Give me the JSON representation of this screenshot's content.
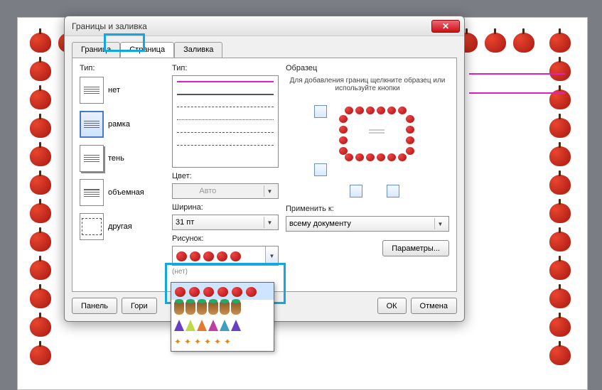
{
  "dialog": {
    "title": "Границы и заливка",
    "tabs": {
      "border": "Граница",
      "page": "Страница",
      "fill": "Заливка"
    },
    "type_label": "Тип:",
    "settings": {
      "none": "нет",
      "box": "рамка",
      "shadow": "тень",
      "volume": "объемная",
      "other": "другая"
    },
    "style_label": "Тип:",
    "color_label": "Цвет:",
    "color_value": "Авто",
    "width_label": "Ширина:",
    "width_value": "31 пт",
    "art_label": "Рисунок:",
    "art_none": "(нет)",
    "preview_label": "Образец",
    "preview_hint": "Для добавления границ щелкните образец или используйте кнопки",
    "apply_label": "Применить к:",
    "apply_value": "всему документу",
    "params_btn": "Параметры...",
    "panel_btn": "Панель",
    "hline_btn": "Гори",
    "ok_btn": "ОК",
    "cancel_btn": "Отмена"
  }
}
